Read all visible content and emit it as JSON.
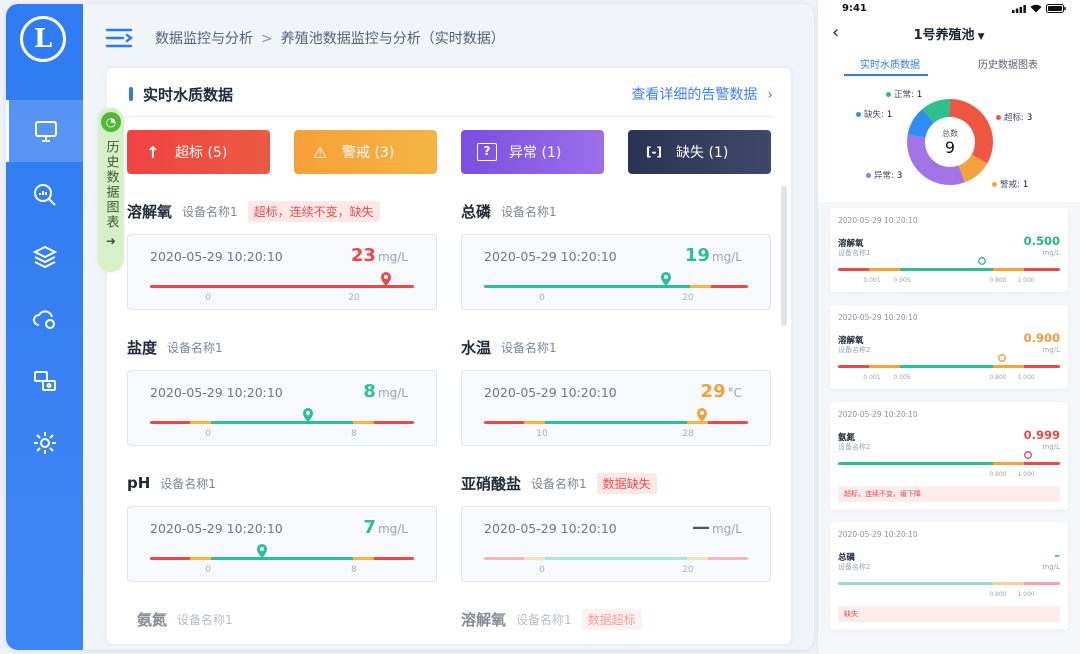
{
  "app": {
    "logo_letter": "L",
    "breadcrumb": [
      "数据监控与分析",
      "养殖池数据监控与分析（实时数据）"
    ],
    "breadcrumb_sep": ">"
  },
  "sidebar": {
    "items": [
      {
        "icon": "monitor-icon",
        "active": true
      },
      {
        "icon": "search-chart-icon",
        "active": false
      },
      {
        "icon": "layers-icon",
        "active": false
      },
      {
        "icon": "cloud-settings-icon",
        "active": false
      },
      {
        "icon": "devices-icon",
        "active": false
      },
      {
        "icon": "gear-icon",
        "active": false
      }
    ]
  },
  "history_tab": {
    "label": "历史数据图表",
    "arrow": "➜"
  },
  "panel": {
    "title": "实时水质数据",
    "link": "查看详细的告警数据",
    "link_chevron": "›",
    "status_buttons": [
      {
        "icon": "↑",
        "label": "超标 (5)"
      },
      {
        "icon": "⚠",
        "label": "警戒 (3)"
      },
      {
        "icon": "?",
        "label": "异常 (1)"
      },
      {
        "icon": "[-]",
        "label": "缺失 (1)"
      }
    ],
    "sensors": [
      {
        "name": "溶解氧",
        "device": "设备名称1",
        "tag": "超标，连续不变，缺失",
        "time": "2020-05-29 10:20:10",
        "value": "23",
        "unit": "mg/L",
        "value_color": "#e84a4a",
        "ticks": [
          "0",
          "20"
        ]
      },
      {
        "name": "总磷",
        "device": "设备名称1",
        "tag": "",
        "time": "2020-05-29 10:20:10",
        "value": "19",
        "unit": "mg/L",
        "value_color": "#2bbf9a",
        "ticks": [
          "0",
          "20"
        ]
      },
      {
        "name": "盐度",
        "device": "设备名称1",
        "tag": "",
        "time": "2020-05-29 10:20:10",
        "value": "8",
        "unit": "mg/L",
        "value_color": "#2bbf9a",
        "ticks": [
          "0",
          "8"
        ]
      },
      {
        "name": "水温",
        "device": "设备名称1",
        "tag": "",
        "time": "2020-05-29 10:20:10",
        "value": "29",
        "unit": "°C",
        "value_color": "#f0a33a",
        "ticks": [
          "10",
          "28"
        ]
      },
      {
        "name": "pH",
        "device": "设备名称1",
        "tag": "",
        "time": "2020-05-29 10:20:10",
        "value": "7",
        "unit": "mg/L",
        "value_color": "#2bbf9a",
        "ticks": [
          "0",
          "8"
        ]
      },
      {
        "name": "亚硝酸盐",
        "device": "设备名称1",
        "tag": "数据缺失",
        "time": "2020-05-29 10:20:10",
        "value": "—",
        "unit": "mg/L",
        "value_color": "#555555",
        "ticks": [
          "0",
          "20"
        ]
      }
    ],
    "bottom_rows": [
      {
        "name": "氨氮",
        "device": "设备名称1",
        "tag": ""
      },
      {
        "name": "溶解氧",
        "device": "设备名称1",
        "tag": "数据超标"
      }
    ]
  },
  "phone": {
    "time": "9:41",
    "back": "‹",
    "title": "1号养殖池",
    "caret": "▼",
    "tabs": [
      "实时水质数据",
      "历史数据图表"
    ],
    "donut": {
      "center_label": "总数",
      "center_value": "9",
      "segments": [
        {
          "label": "超标",
          "value": 3,
          "color": "#ef5743"
        },
        {
          "label": "警戒",
          "value": 1,
          "color": "#f4a340"
        },
        {
          "label": "异常",
          "value": 3,
          "color": "#a274e6"
        },
        {
          "label": "缺失",
          "value": 1,
          "color": "#2e8ef5"
        },
        {
          "label": "正常",
          "value": 1,
          "color": "#2fbf8e"
        }
      ]
    },
    "cards": [
      {
        "time": "2020-05-29 10:20:10",
        "name": "溶解氧",
        "device": "设备名称1",
        "value": "0.500",
        "unit": "mg/L",
        "value_color": "#2bb47e",
        "ticks": [
          "0.001",
          "0.005",
          "0.800",
          "1.000"
        ],
        "alert": ""
      },
      {
        "time": "2020-05-29 10:20:10",
        "name": "溶解氧",
        "device": "设备名称2",
        "value": "0.900",
        "unit": "mg/L",
        "value_color": "#ef9b3a",
        "ticks": [
          "0.001",
          "0.005",
          "0.800",
          "1.000"
        ],
        "alert": ""
      },
      {
        "time": "2020-05-29 10:20:10",
        "name": "氨氮",
        "device": "设备名称2",
        "value": "0.999",
        "unit": "mg/L",
        "value_color": "#e84a4a",
        "ticks": [
          "0.800",
          "1.000"
        ],
        "alert": "超标，连续不变，缓下降"
      },
      {
        "time": "2020-05-29 10:20:10",
        "name": "总磷",
        "device": "设备名称2",
        "value": "–",
        "unit": "mg/L",
        "value_color": "#2bb47e",
        "ticks": [
          "0.800",
          "1.000"
        ],
        "alert": "缺失"
      }
    ]
  }
}
